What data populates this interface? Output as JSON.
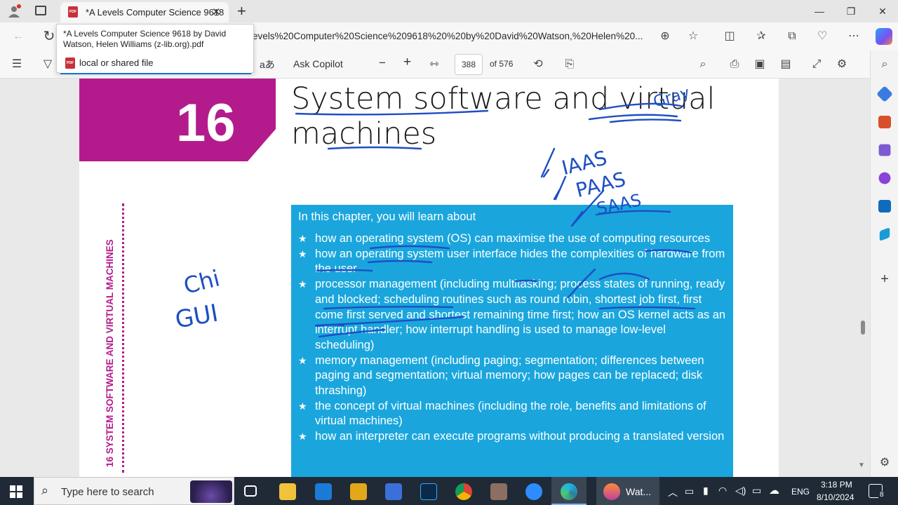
{
  "browser": {
    "tab_title": "*A Levels Computer Science 9618",
    "new_tab_symbol": "+",
    "url": "evels%20Computer%20Science%209618%20%20by%20David%20Watson,%20Helen%20...",
    "tooltip": {
      "title": "*A Levels Computer Science 9618 by David Watson, Helen Williams (z-lib.org).pdf",
      "source": "local or shared file"
    }
  },
  "pdf_toolbar": {
    "read_aloud": "aあ",
    "ask_copilot": "Ask Copilot",
    "zoom_out": "−",
    "zoom_in": "+",
    "page_current": "388",
    "page_total": "of 576"
  },
  "page": {
    "chapter_number": "16",
    "chapter_title": "System software and virtual machines",
    "side_heading": "16 SYSTEM SOFTWARE AND VIRTUAL MACHINES",
    "learn_intro": "In this chapter, you will learn about",
    "learn_items": [
      "how an operating system (OS) can maximise the use of computing resources",
      "how an operating system user interface hides the complexities of hardware from the user",
      "processor management (including multitasking; process states of running, ready and blocked; scheduling routines such as round robin, shortest job first, first come first served and shortest remaining time first; how an OS kernel acts as an interrupt handler; how interrupt handling is used to manage low-level scheduling)",
      "memory management (including paging; segmentation; differences between paging and segmentation; virtual memory; how pages can be replaced; disk thrashing)",
      "the concept of virtual machines (including the role, benefits and limitations of virtual machines)",
      "how an interpreter can execute programs without producing a translated version"
    ],
    "handwriting": {
      "iaas": "IAAS",
      "paas": "PAAS",
      "saas": "SAAS",
      "chi": "Chi",
      "gui": "GUI",
      "gray": "Gray"
    }
  },
  "taskbar": {
    "search_placeholder": "Type here to search",
    "active_app_label": "Wat...",
    "language": "ENG",
    "time": "3:18 PM",
    "date": "8/10/2024",
    "notification_count": "8"
  },
  "colors": {
    "chapter_magenta": "#b31b8d",
    "learn_box_blue": "#1aa6dd",
    "ink_blue": "#1d4fc4",
    "taskbar": "#1f2a36"
  }
}
